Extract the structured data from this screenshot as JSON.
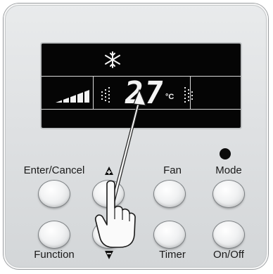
{
  "display": {
    "mode_icon": "snowflake-icon",
    "temperature": "27",
    "unit": "°C",
    "fan_icon_left": "fan-speed-icon",
    "fan_icon_right": "fan-speed-icon",
    "signal_icon": "signal-strength-icon"
  },
  "buttons": {
    "enter_cancel": "Enter/Cancel",
    "up_icon": "triangle-up-plus-icon",
    "fan": "Fan",
    "mode": "Mode",
    "function": "Function",
    "down_icon": "triangle-down-icon",
    "timer": "Timer",
    "on_off": "On/Off"
  },
  "annotation": {
    "pointer": "hand-pointer-icon",
    "arrow": "arrow-to-temperature-icon"
  },
  "colors": {
    "panel": "#dfe1e3",
    "screen": "#050505",
    "screen_text": "#f4f4f4"
  }
}
